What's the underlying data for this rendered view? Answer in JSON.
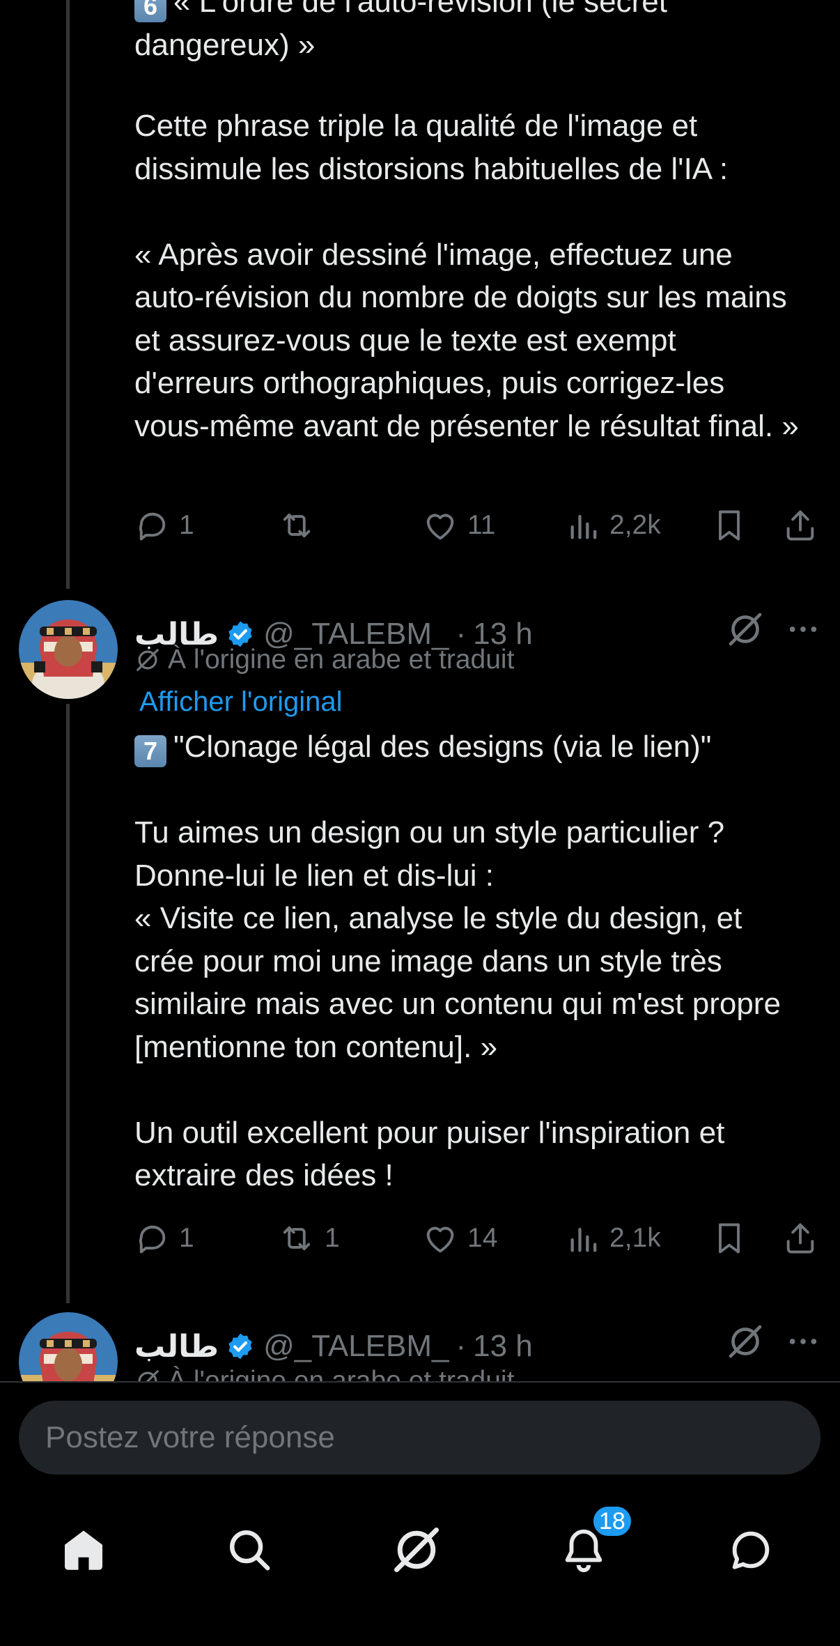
{
  "tweet_prev": {
    "heading_number": "6",
    "heading_text": "« L'ordre de l'auto-révision (le secret dangereux) »",
    "body_text": "Cette phrase triple la qualité de l'image et dissimule les distorsions habituelles de l'IA :\n\n« Après avoir dessiné l'image, effectuez une auto-révision du nombre de doigts sur les mains et assurez-vous que le texte est exempt d'erreurs orthographiques, puis corrigez-les vous-même avant de présenter le résultat final. »",
    "replies": "1",
    "reposts": "",
    "likes": "11",
    "views": "2,2k"
  },
  "tweet_main": {
    "author_name": "طالب",
    "handle": "@_TALEBM_",
    "separator": "·",
    "time": "13 h",
    "translated_note": "À l'origine en arabe et traduit",
    "show_original": "Afficher l'original",
    "heading_number": "7",
    "heading_text": "\"Clonage légal des designs (via le lien)\"",
    "body_text": "Tu aimes un design ou un style particulier ?\nDonne-lui le lien et dis-lui :\n« Visite ce lien, analyse le style du design, et crée pour moi une image dans un style très similaire mais avec un contenu qui m'est propre [mentionne ton contenu]. »\n\nUn outil excellent pour puiser l'inspiration et extraire des idées !",
    "replies": "1",
    "reposts": "1",
    "likes": "14",
    "views": "2,1k"
  },
  "tweet_next": {
    "author_name": "طالب",
    "handle": "@_TALEBM_",
    "separator": "·",
    "time": "13 h",
    "translated_note": "À l'origine en arabe et traduit"
  },
  "reply": {
    "placeholder": "Postez votre réponse"
  },
  "nav": {
    "notifications_count": "18",
    "items": [
      "home-icon",
      "search-icon",
      "grok-icon",
      "bell-icon",
      "messages-icon"
    ]
  },
  "colors": {
    "background": "#000000",
    "text": "#e7e9ea",
    "muted": "#71767b",
    "accent": "#1d9bf0"
  }
}
